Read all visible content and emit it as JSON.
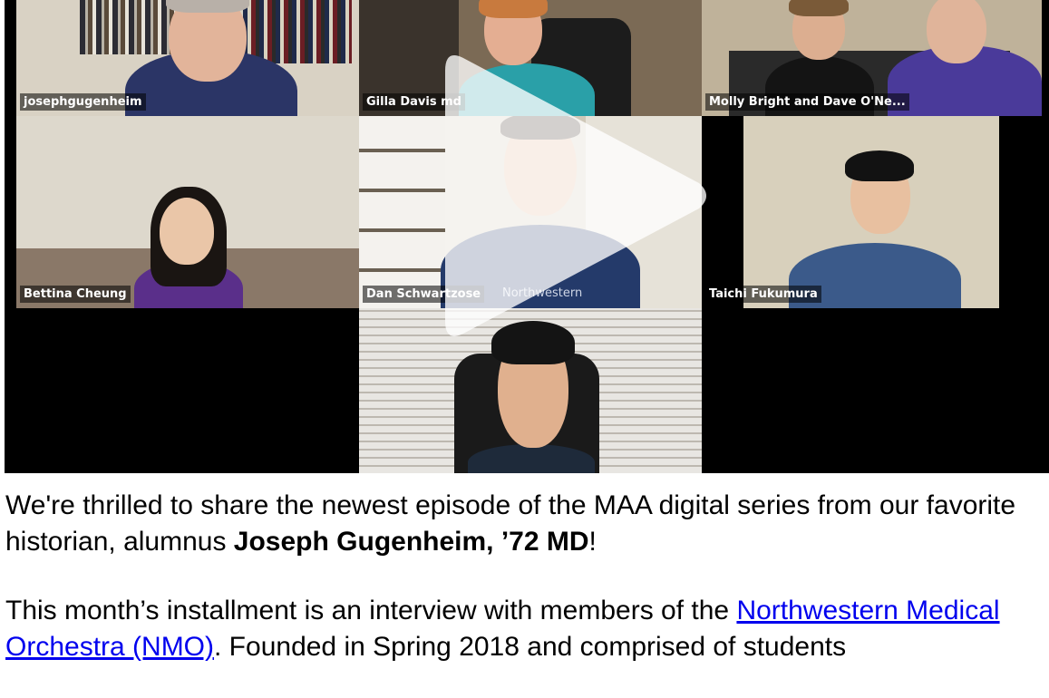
{
  "video": {
    "participants": [
      {
        "name": "josephgugenheim"
      },
      {
        "name": "Gilla Davis md"
      },
      {
        "name": "Molly Bright and Dave O'Ne..."
      },
      {
        "name": "Bettina Cheung"
      },
      {
        "name": "Dan Schwartzose"
      },
      {
        "name": "Taichi Fukumura"
      },
      {
        "name": ""
      }
    ],
    "shirt_text": "Northwestern"
  },
  "article": {
    "p1_intro": "We're thrilled to share the newest episode of the MAA digital series from our favorite historian, alumnus ",
    "p1_bold": "Joseph Gugenheim, ’72 MD",
    "p1_end": "!",
    "p2_intro": "This month’s installment is an interview with members of the ",
    "p2_link": "Northwestern Medical Orchestra (NMO)",
    "p2_rest": ". Founded in Spring 2018 and comprised of students"
  },
  "colors": {
    "link": "#0000ee",
    "video_bg": "#000000",
    "play_overlay": "rgba(255,255,255,0.78)"
  },
  "icons": {
    "play": "play-icon"
  }
}
